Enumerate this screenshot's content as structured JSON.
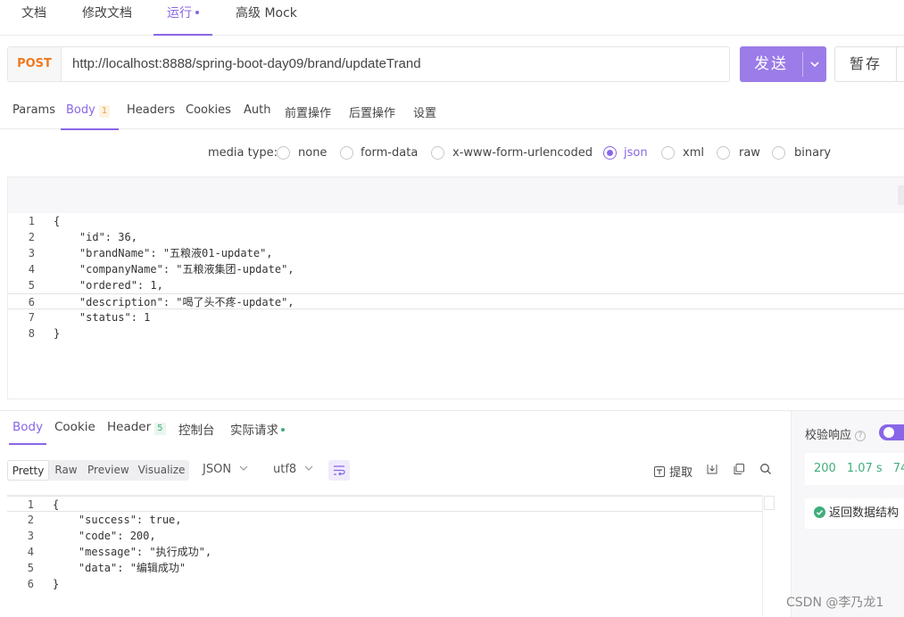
{
  "top_tabs": [
    {
      "label": "文档"
    },
    {
      "label": "修改文档"
    },
    {
      "label": "运行"
    },
    {
      "label": "高级 Mock"
    }
  ],
  "request": {
    "method": "POST",
    "url": "http://localhost:8888/spring-boot-day09/brand/updateTrand",
    "send_label": "发送",
    "save_label": "暂存"
  },
  "request_tabs": [
    {
      "label": "Params"
    },
    {
      "label": "Body",
      "badge": "1"
    },
    {
      "label": "Headers"
    },
    {
      "label": "Cookies"
    },
    {
      "label": "Auth"
    },
    {
      "label": "前置操作"
    },
    {
      "label": "后置操作"
    },
    {
      "label": "设置"
    }
  ],
  "media_type": {
    "label": "media type:",
    "options": [
      "none",
      "form-data",
      "x-www-form-urlencoded",
      "json",
      "xml",
      "raw",
      "binary"
    ],
    "selected": "json"
  },
  "request_body": {
    "line_numbers": [
      "1",
      "2",
      "3",
      "4",
      "5",
      "6",
      "7",
      "8"
    ],
    "lines": [
      "{",
      "    \"id\": 36,",
      "    \"brandName\": \"五粮液01-update\",",
      "    \"companyName\": \"五粮液集团-update\",",
      "    \"ordered\": 1,",
      "    \"description\": \"喝了头不疼-update\",",
      "    \"status\": 1",
      "}"
    ]
  },
  "response_tabs": [
    {
      "label": "Body"
    },
    {
      "label": "Cookie"
    },
    {
      "label": "Header",
      "badge": "5"
    },
    {
      "label": "控制台"
    },
    {
      "label": "实际请求"
    }
  ],
  "response_view": {
    "modes": [
      "Pretty",
      "Raw",
      "Preview",
      "Visualize"
    ],
    "format": "JSON",
    "encoding": "utf8",
    "extract_label": "提取"
  },
  "response_body": {
    "line_numbers": [
      "1",
      "2",
      "3",
      "4",
      "5",
      "6"
    ],
    "lines": [
      "{",
      "    \"success\": true,",
      "    \"code\": 200,",
      "    \"message\": \"执行成功\",",
      "    \"data\": \"编辑成功\"",
      "}"
    ]
  },
  "right_panel": {
    "title": "校验响应",
    "help": "?",
    "status_code": "200",
    "time": "1.07 s",
    "size": "74",
    "check_label": "返回数据结构"
  },
  "watermark": "CSDN @李乃龙1",
  "colors": {
    "accent": "#8866e8",
    "send_button": "#9b7ce8",
    "method": "#f0791f",
    "success": "#3fae7a"
  }
}
